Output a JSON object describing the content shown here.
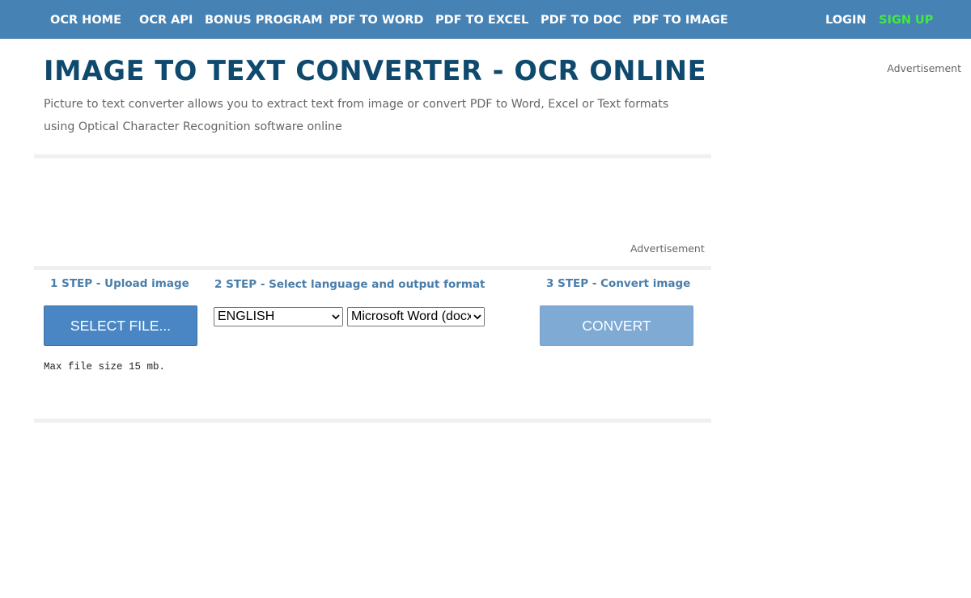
{
  "nav": {
    "links": [
      {
        "label": "OCR HOME"
      },
      {
        "label": "OCR API"
      },
      {
        "label": "BONUS PROGRAM"
      },
      {
        "label": "PDF TO WORD"
      },
      {
        "label": "PDF TO EXCEL"
      },
      {
        "label": "PDF TO DOC"
      },
      {
        "label": "PDF TO IMAGE"
      }
    ],
    "login": "LOGIN",
    "signup": "SIGN UP",
    "colors": {
      "bar": "#4682b4",
      "link": "#ffffff",
      "signup": "#45e845"
    }
  },
  "header": {
    "title": "IMAGE TO TEXT CONVERTER - OCR ONLINE",
    "description": "Picture to text converter allows you to extract text from image or convert PDF to Word, Excel or Text formats using Optical Character Recognition software online",
    "title_color": "#0f4a6e"
  },
  "ads": {
    "sidebar_label": "Advertisement",
    "inline_label": "Advertisement"
  },
  "steps": {
    "step1": {
      "label": "1 STEP - Upload image",
      "button": "SELECT FILE...",
      "note": "Max file size 15 mb."
    },
    "step2": {
      "label": "2 STEP - Select language and output format",
      "language": "ENGLISH",
      "format": "Microsoft Word (docx)",
      "icon": "chevron-down-icon"
    },
    "step3": {
      "label": "3 STEP - Convert image",
      "button": "CONVERT"
    },
    "colors": {
      "label": "#4a7eaa",
      "select_button": "#4a86c3",
      "convert_button": "#7faad4"
    }
  }
}
